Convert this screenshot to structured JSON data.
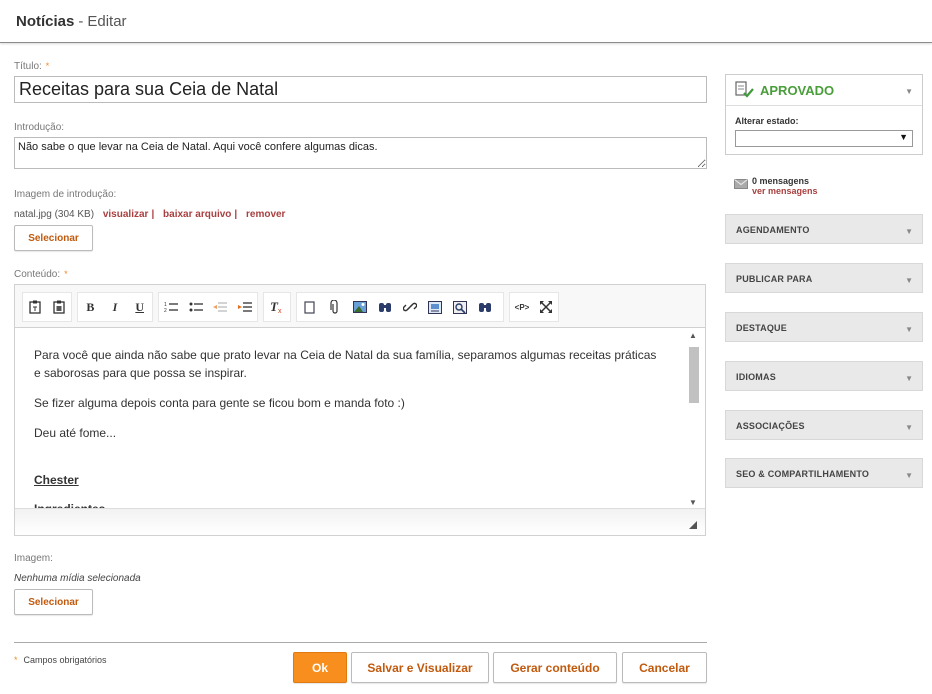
{
  "header": {
    "title": "Notícias",
    "separator": "-",
    "subtitle": "Editar"
  },
  "form": {
    "titulo_label": "Título:",
    "titulo_value": "Receitas para sua Ceia de Natal",
    "intro_label": "Introdução:",
    "intro_value": "Não sabe o que levar na Ceia de Natal. Aqui você confere algumas dicas.",
    "img_intro_label": "Imagem de introdução:",
    "file_name": "natal.jpg (304 KB)",
    "link_view": "visualizar",
    "link_download": "baixar arquivo",
    "link_remove": "remover",
    "pipe": "|",
    "select_label": "Selecionar",
    "content_label": "Conteúdo:",
    "required_mark": "*",
    "imagem_label": "Imagem:",
    "no_media": "Nenhuma mídia selecionada"
  },
  "editor": {
    "paragraphs": [
      "Para você que ainda não sabe que prato levar na Ceia de Natal da sua família, separamos algumas receitas práticas e saborosas para que possa se inspirar.",
      "Se fizer alguma depois conta para gente se ficou bom e manda foto :)",
      "Deu até fome...",
      "Chester",
      "Ingredientes"
    ],
    "toolbar_glyphs": {
      "bold": "B",
      "italic": "I",
      "underline": "U",
      "source": "<P>"
    }
  },
  "footer": {
    "required_note": "Campos obrigatórios",
    "ok": "Ok",
    "save_view": "Salvar e Visualizar",
    "generate": "Gerar conteúdo",
    "cancel": "Cancelar"
  },
  "sidebar": {
    "status": "APROVADO",
    "alter_label": "Alterar estado:",
    "messages_count": "0 mensagens",
    "messages_link": "ver mensagens",
    "panels": [
      "AGENDAMENTO",
      "PUBLICAR PARA",
      "DESTAQUE",
      "IDIOMAS",
      "ASSOCIAÇÕES",
      "SEO & COMPARTILHAMENTO"
    ]
  },
  "colors": {
    "accent": "#f88e1d",
    "link": "#a93f3f",
    "status_green": "#4a9d3b",
    "button_text": "#c25a0e"
  }
}
